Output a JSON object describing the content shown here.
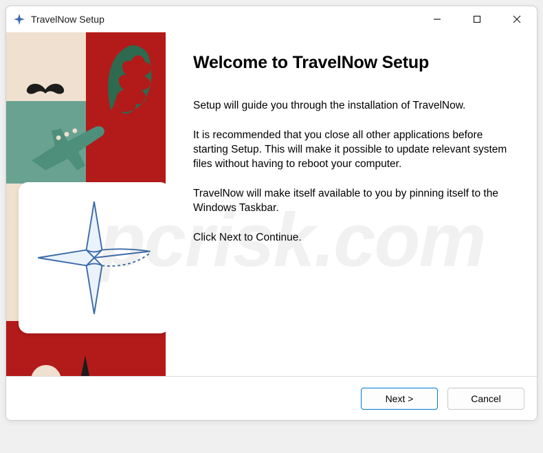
{
  "window": {
    "title": "TravelNow Setup"
  },
  "heading": "Welcome to TravelNow Setup",
  "paragraphs": {
    "p1": "Setup will guide you through the installation of TravelNow.",
    "p2": "It is recommended that you close all other applications before starting Setup.  This will make it possible to update relevant system files without having to reboot your computer.",
    "p3": "TravelNow will make itself available to you by pinning itself to the Windows Taskbar.",
    "p4": "Click Next to Continue."
  },
  "buttons": {
    "next": "Next >",
    "cancel": "Cancel"
  },
  "watermark": "pcrisk.com",
  "icons": {
    "app": "compass-plane-icon",
    "minimize": "minimize-icon",
    "maximize": "maximize-icon",
    "close": "close-icon"
  }
}
